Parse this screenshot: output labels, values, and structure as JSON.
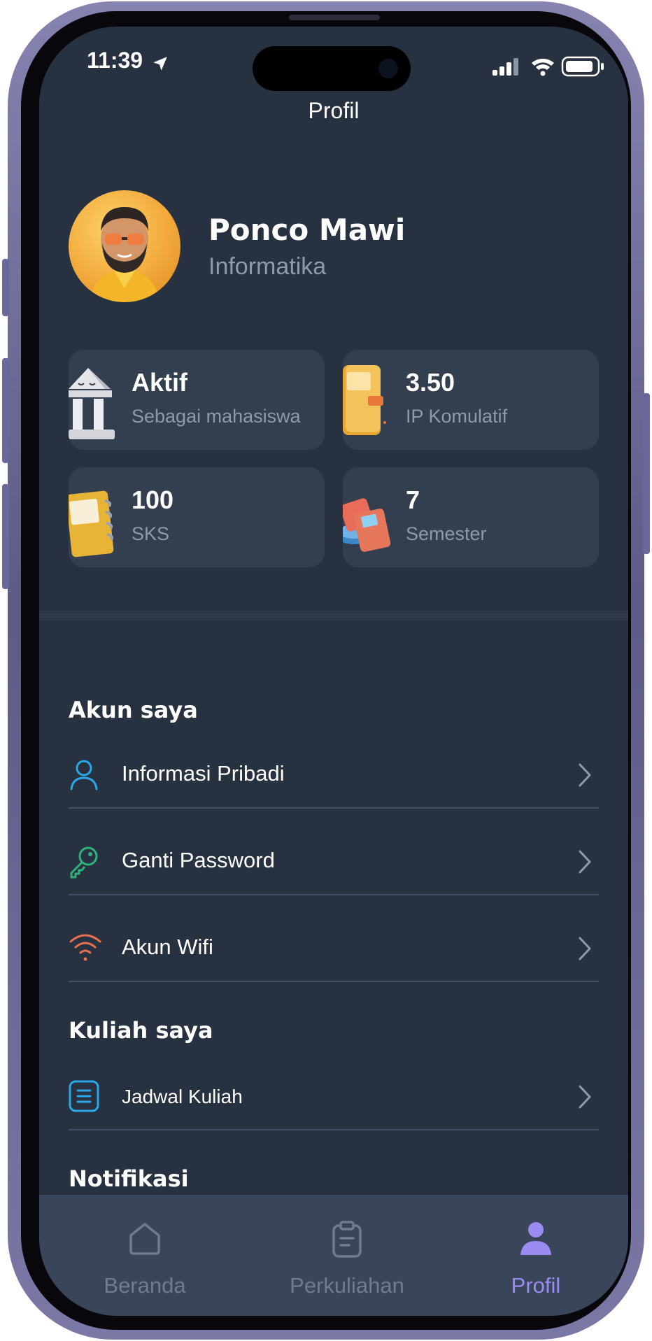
{
  "status_bar": {
    "time": "11:39"
  },
  "header": {
    "title": "Profil"
  },
  "profile": {
    "name": "Ponco Mawi",
    "major": "Informatika"
  },
  "stats": [
    {
      "value": "Aktif",
      "label": "Sebagai mahasiswa",
      "icon": "institution-icon"
    },
    {
      "value": "3.50",
      "label": "IP Komulatif",
      "icon": "book-icon"
    },
    {
      "value": "100",
      "label": "SKS",
      "icon": "notebook-icon"
    },
    {
      "value": "7",
      "label": "Semester",
      "icon": "books-stack-icon"
    }
  ],
  "sections": {
    "akun": {
      "title": "Akun saya",
      "items": [
        {
          "label": "Informasi Pribadi",
          "icon": "user-icon",
          "color": "#2aa7e6"
        },
        {
          "label": "Ganti Password",
          "icon": "key-icon",
          "color": "#2fb27c"
        },
        {
          "label": "Akun Wifi",
          "icon": "wifi-icon",
          "color": "#e9714f"
        }
      ]
    },
    "kuliah": {
      "title": "Kuliah saya",
      "items": [
        {
          "label": "Jadwal Kuliah",
          "icon": "schedule-icon",
          "color": "#2aa7e6"
        }
      ]
    },
    "notifikasi": {
      "title": "Notifikasi"
    }
  },
  "bottom_nav": {
    "items": [
      {
        "label": "Beranda",
        "icon": "home-icon",
        "active": false
      },
      {
        "label": "Perkuliahan",
        "icon": "clipboard-icon",
        "active": false
      },
      {
        "label": "Profil",
        "icon": "person-icon",
        "active": true
      }
    ],
    "active_color": "#9b8cf2",
    "inactive_color": "#6f7b8e"
  }
}
